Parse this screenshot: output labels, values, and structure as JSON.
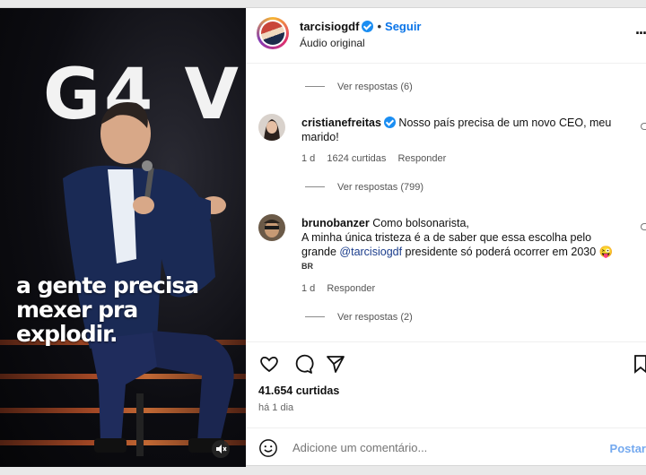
{
  "media": {
    "brand_text": "G4 V",
    "caption_line1": "a gente precisa",
    "caption_line2": "mexer pra explodir."
  },
  "header": {
    "username": "tarcisiogdf",
    "separator": "•",
    "follow_label": "Seguir",
    "audio_label": "Áudio original",
    "more_label": "···"
  },
  "comments": {
    "replies_top": "Ver respostas (6)",
    "items": [
      {
        "username": "cristianefreitas",
        "text": "Nosso país precisa de um novo CEO, meu marido!",
        "time": "1 d",
        "likes": "1624 curtidas",
        "reply": "Responder",
        "replies": "Ver respostas (799)"
      },
      {
        "username": "brunobanzer",
        "text_line1": "Como bolsonarista,",
        "text_line2": "A minha única tristeza é a de saber que essa escolha pelo",
        "text_line3_pre": "grande ",
        "mention": "@tarcisiogdf",
        "text_line3_post": " presidente só poderá ocorrer em 2030 😜",
        "flag": "BR",
        "time": "1 d",
        "reply": "Responder",
        "replies": "Ver respostas (2)"
      }
    ]
  },
  "footer": {
    "likes": "41.654 curtidas",
    "time": "há 1 dia",
    "comment_placeholder": "Adicione um comentário...",
    "post_label": "Postar"
  },
  "colors": {
    "accent": "#0a74e8",
    "verified": "#1b8ef2",
    "post_disabled": "#74a9ef"
  }
}
